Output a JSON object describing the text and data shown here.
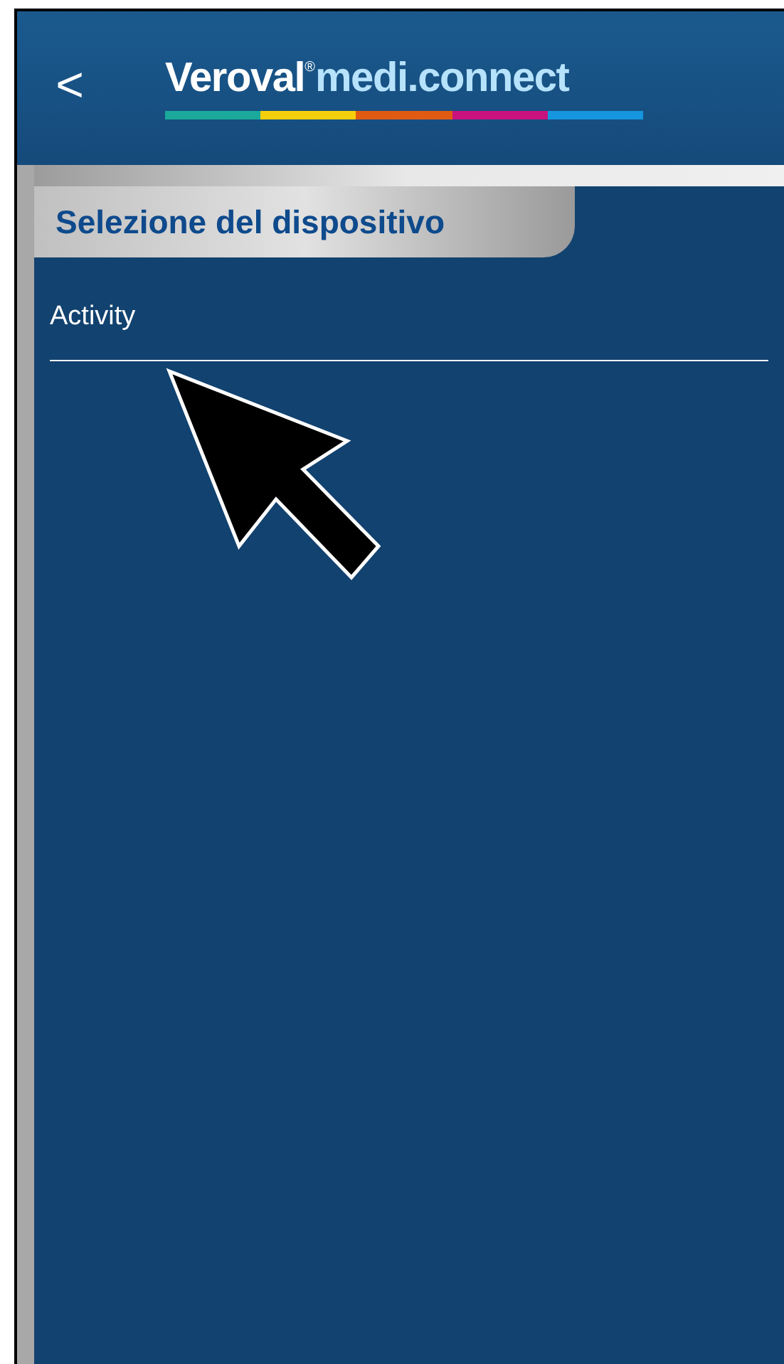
{
  "header": {
    "back": "<",
    "brand": "Veroval",
    "brand_mark": "®",
    "product": "medi.connect",
    "stripe": [
      {
        "color": "#1aa99a"
      },
      {
        "color": "#f6cf0c"
      },
      {
        "color": "#e15a12"
      },
      {
        "color": "#c8127e"
      },
      {
        "color": "#1596de"
      }
    ]
  },
  "section": {
    "title": "Selezione del dispositivo"
  },
  "devices": [
    {
      "label": "Activity"
    }
  ],
  "pointer": {
    "kind": "arrow"
  }
}
